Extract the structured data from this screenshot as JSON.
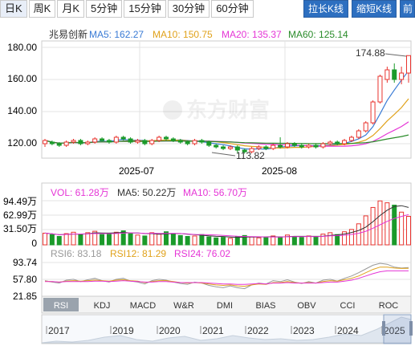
{
  "top_tabs": [
    "日K",
    "周K",
    "月K",
    "5分钟",
    "15分钟",
    "30分钟",
    "60分钟"
  ],
  "right_buttons": [
    "拉长K线",
    "缩短K线",
    "前"
  ],
  "stock_name": "兆易创新",
  "watermark": "东方财富",
  "ma_legend": [
    {
      "label": "MA5: 162.27",
      "color": "#3a7bd5"
    },
    {
      "label": "MA10: 150.75",
      "color": "#e0a21b"
    },
    {
      "label": "MA20: 135.37",
      "color": "#e535d6"
    },
    {
      "label": "MA60: 125.14",
      "color": "#2a8c2a"
    }
  ],
  "price_axis": [
    "180.00",
    "160.00",
    "140.00",
    "120.00"
  ],
  "x_dates": [
    "2025-07",
    "2025-08"
  ],
  "annotations": {
    "high": "174.88",
    "low": "113.82"
  },
  "vol_legend": [
    {
      "label": "VOL: 61.28万",
      "color": "#e535d6"
    },
    {
      "label": "MA5: 50.22万",
      "color": "#333333"
    },
    {
      "label": "MA10: 56.70万",
      "color": "#e535d6"
    }
  ],
  "vol_axis": [
    "94.49万",
    "62.99万",
    "31.50万",
    "0"
  ],
  "rsi_legend": [
    {
      "label": "RSI6: 83.18",
      "color": "#999999"
    },
    {
      "label": "RSI12: 81.29",
      "color": "#e0a21b"
    },
    {
      "label": "RSI24: 76.02",
      "color": "#e535d6"
    }
  ],
  "rsi_axis": [
    "93.74",
    "57.80",
    "21.85"
  ],
  "indicator_tabs": [
    "RSI",
    "KDJ",
    "MACD",
    "W&R",
    "DMI",
    "BIAS",
    "OBV",
    "CCI",
    "ROC"
  ],
  "timeline_years": [
    "2017",
    "2019",
    "2020",
    "2021",
    "2022",
    "2023",
    "2024",
    "2025"
  ],
  "colors": {
    "up": "#e8332e",
    "down": "#1a9a2a",
    "grid": "#e3e3e3",
    "axis": "#999999"
  },
  "chart_data": {
    "type": "candlestick",
    "y_range": [
      110,
      182
    ],
    "candles": [
      [
        120,
        122,
        118,
        123
      ],
      [
        121,
        120,
        119,
        122
      ],
      [
        120,
        119,
        118,
        121
      ],
      [
        119,
        121,
        118,
        122
      ],
      [
        121,
        122,
        120,
        123
      ],
      [
        122,
        120,
        119,
        123
      ],
      [
        120,
        121,
        119,
        122
      ],
      [
        121,
        123,
        120,
        124
      ],
      [
        123,
        122,
        121,
        124
      ],
      [
        122,
        121,
        120,
        123
      ],
      [
        121,
        124,
        120,
        125
      ],
      [
        124,
        123,
        122,
        125
      ],
      [
        123,
        121,
        120,
        124
      ],
      [
        121,
        122,
        120,
        123
      ],
      [
        122,
        120,
        119,
        123
      ],
      [
        120,
        122,
        119,
        123
      ],
      [
        122,
        124,
        121,
        125
      ],
      [
        124,
        123,
        122,
        125
      ],
      [
        123,
        122,
        121,
        124
      ],
      [
        122,
        121,
        120,
        123
      ],
      [
        121,
        120,
        119,
        122
      ],
      [
        120,
        122,
        119,
        123
      ],
      [
        122,
        121,
        120,
        123
      ],
      [
        121,
        119,
        118,
        122
      ],
      [
        119,
        118,
        117,
        120
      ],
      [
        118,
        117,
        116,
        119
      ],
      [
        117,
        118,
        116,
        119
      ],
      [
        118,
        116,
        114,
        119
      ],
      [
        116,
        115,
        113.82,
        117
      ],
      [
        115,
        117,
        114,
        118
      ],
      [
        117,
        118,
        116,
        119
      ],
      [
        118,
        117,
        116,
        119
      ],
      [
        117,
        119,
        116,
        120
      ],
      [
        119,
        118,
        117,
        124
      ],
      [
        118,
        120,
        117,
        121
      ],
      [
        120,
        119,
        118,
        121
      ],
      [
        119,
        118,
        117,
        120
      ],
      [
        118,
        119,
        117,
        120
      ],
      [
        119,
        118,
        117,
        120
      ],
      [
        118,
        120,
        117,
        121
      ],
      [
        120,
        121,
        119,
        122
      ],
      [
        121,
        120,
        119,
        122
      ],
      [
        120,
        122,
        119,
        123
      ],
      [
        122,
        124,
        121,
        125
      ],
      [
        124,
        128,
        123,
        129
      ],
      [
        128,
        133,
        127,
        134
      ],
      [
        133,
        146,
        132,
        147
      ],
      [
        146,
        162,
        145,
        163
      ],
      [
        160,
        166,
        158,
        168
      ],
      [
        166,
        160,
        158,
        170
      ],
      [
        160,
        164,
        157,
        168
      ],
      [
        164,
        174.88,
        158,
        174.88
      ]
    ],
    "volumes": [
      25,
      22,
      18,
      24,
      27,
      23,
      26,
      29,
      22,
      25,
      27,
      30,
      24,
      21,
      19,
      26,
      23,
      28,
      24,
      20,
      18,
      19,
      22,
      17,
      15,
      16,
      14,
      18,
      20,
      17,
      15,
      16,
      19,
      17,
      21,
      18,
      16,
      19,
      17,
      23,
      26,
      22,
      28,
      33,
      45,
      62,
      80,
      94,
      90,
      85,
      70,
      61
    ],
    "rsi6": [
      55,
      52,
      50,
      56,
      58,
      53,
      57,
      60,
      55,
      52,
      58,
      60,
      54,
      52,
      48,
      55,
      58,
      56,
      52,
      49,
      47,
      52,
      50,
      45,
      42,
      40,
      44,
      40,
      38,
      46,
      50,
      48,
      55,
      53,
      57,
      52,
      49,
      53,
      50,
      56,
      58,
      54,
      60,
      65,
      72,
      80,
      88,
      92,
      90,
      84,
      82,
      83.18
    ],
    "rsi12": [
      54,
      53,
      52,
      54,
      55,
      54,
      55,
      56,
      55,
      54,
      56,
      57,
      55,
      54,
      51,
      53,
      55,
      55,
      53,
      51,
      50,
      51,
      50,
      48,
      46,
      45,
      46,
      44,
      43,
      46,
      48,
      47,
      51,
      51,
      53,
      51,
      50,
      51,
      50,
      53,
      55,
      54,
      57,
      60,
      65,
      72,
      79,
      84,
      84,
      82,
      81,
      81.29
    ],
    "rsi24": [
      53,
      53,
      52,
      53,
      53,
      53,
      53,
      54,
      54,
      53,
      54,
      55,
      54,
      53,
      52,
      52,
      53,
      53,
      52,
      51,
      51,
      51,
      51,
      50,
      49,
      48,
      48,
      47,
      47,
      48,
      49,
      48,
      50,
      50,
      51,
      50,
      50,
      50,
      50,
      51,
      52,
      52,
      54,
      56,
      60,
      65,
      70,
      74,
      76,
      76,
      76,
      76.02
    ]
  }
}
